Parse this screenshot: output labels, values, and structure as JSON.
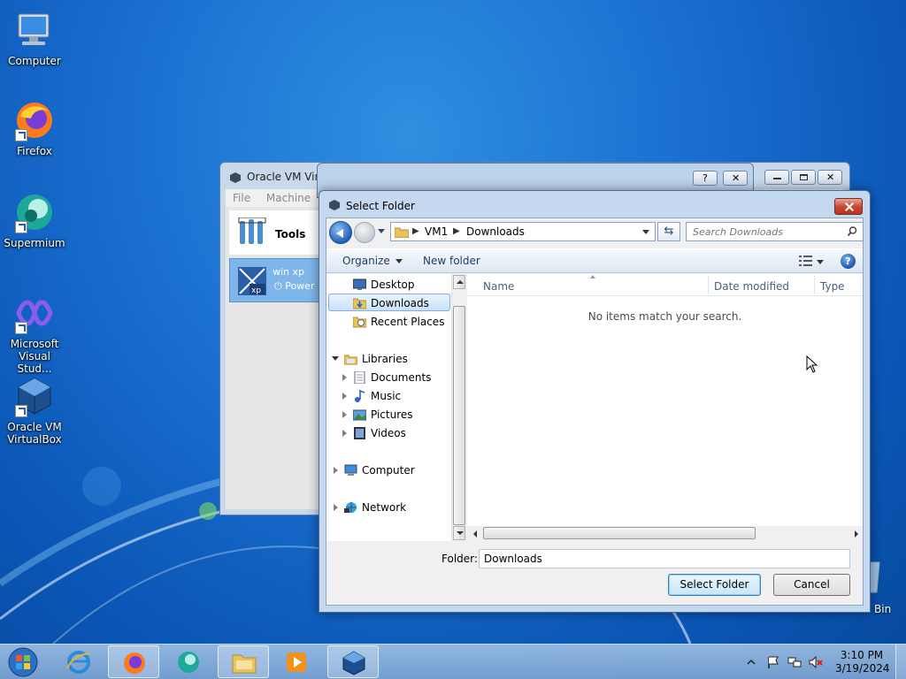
{
  "desktop": {
    "icons": [
      {
        "label": "Computer",
        "icon": "computer-icon"
      },
      {
        "label": "Firefox",
        "icon": "firefox-icon"
      },
      {
        "label": "Supermium",
        "icon": "supermium-icon"
      },
      {
        "label": "Microsoft Visual Stud...",
        "icon": "visual-studio-icon"
      },
      {
        "label": "Oracle VM VirtualBox",
        "icon": "virtualbox-icon"
      }
    ],
    "recycle_bin_label": "Bin"
  },
  "vbox_window": {
    "title": "Oracle VM Virtu",
    "menu": [
      "File",
      "Machine"
    ],
    "tools_label": "Tools",
    "vm_name": "win xp",
    "vm_state": "Power"
  },
  "dialog": {
    "title": "Select Folder",
    "breadcrumb": [
      "VM1",
      "Downloads"
    ],
    "search_placeholder": "Search Downloads",
    "toolbar": {
      "organize": "Organize",
      "new_folder": "New folder",
      "help": "?"
    },
    "nav": {
      "favorites": [
        "Desktop",
        "Downloads",
        "Recent Places"
      ],
      "libraries_label": "Libraries",
      "libraries": [
        "Documents",
        "Music",
        "Pictures",
        "Videos"
      ],
      "computer": "Computer",
      "network": "Network"
    },
    "selected_nav": "Downloads",
    "columns": [
      "Name",
      "Date modified",
      "Type"
    ],
    "empty_message": "No items match your search.",
    "folder_label": "Folder:",
    "folder_value": "Downloads",
    "select_button": "Select Folder",
    "cancel_button": "Cancel"
  },
  "taskbar": {
    "items": [
      "start-orb",
      "internet-explorer-icon",
      "firefox-icon",
      "supermium-icon",
      "file-explorer-icon",
      "media-player-icon",
      "virtualbox-icon"
    ],
    "clock_time": "3:10 PM",
    "clock_date": "3/19/2024"
  },
  "colors": {
    "desktop_blue": "#1a6fd0",
    "dialog_frame": "#c4d9ef",
    "close_red": "#c74a33",
    "selection": "#c9e2fb"
  }
}
